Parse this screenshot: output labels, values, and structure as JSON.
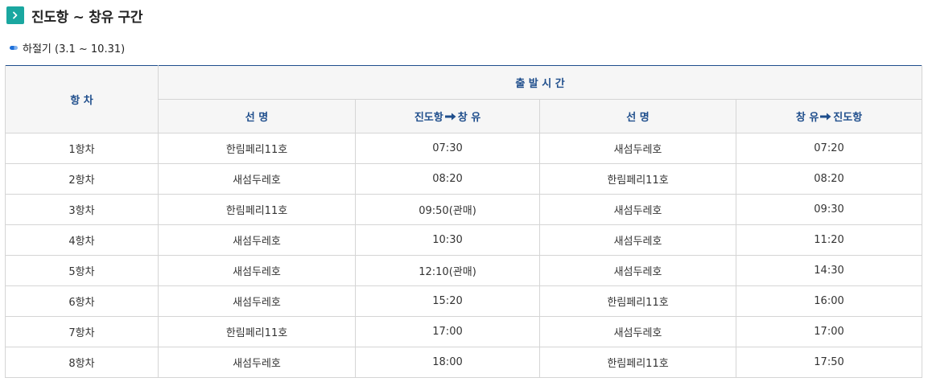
{
  "title": "진도항 ~ 창유 구간",
  "season": "하절기 (3.1 ~ 10.31)",
  "table": {
    "voyage_header": "항 차",
    "departure_header": "출 발 시 간",
    "ship_header_1": "선 명",
    "route_1_from": "진도항",
    "route_1_to": "창 유",
    "ship_header_2": "선 명",
    "route_2_from": "창 유",
    "route_2_to": "진도항",
    "rows": [
      {
        "voyage": "1항차",
        "ship1": "한림페리11호",
        "time1": "07:30",
        "ship2": "새섬두레호",
        "time2": "07:20"
      },
      {
        "voyage": "2항차",
        "ship1": "새섬두레호",
        "time1": "08:20",
        "ship2": "한림페리11호",
        "time2": "08:20"
      },
      {
        "voyage": "3항차",
        "ship1": "한림페리11호",
        "time1": "09:50(관매)",
        "ship2": "새섬두레호",
        "time2": "09:30"
      },
      {
        "voyage": "4항차",
        "ship1": "새섬두레호",
        "time1": "10:30",
        "ship2": "새섬두레호",
        "time2": "11:20"
      },
      {
        "voyage": "5항차",
        "ship1": "새섬두레호",
        "time1": "12:10(관매)",
        "ship2": "새섬두레호",
        "time2": "14:30"
      },
      {
        "voyage": "6항차",
        "ship1": "새섬두레호",
        "time1": "15:20",
        "ship2": "한림페리11호",
        "time2": "16:00"
      },
      {
        "voyage": "7항차",
        "ship1": "한림페리11호",
        "time1": "17:00",
        "ship2": "새섬두레호",
        "time2": "17:00"
      },
      {
        "voyage": "8항차",
        "ship1": "새섬두레호",
        "time1": "18:00",
        "ship2": "한림페리11호",
        "time2": "17:50"
      }
    ]
  }
}
